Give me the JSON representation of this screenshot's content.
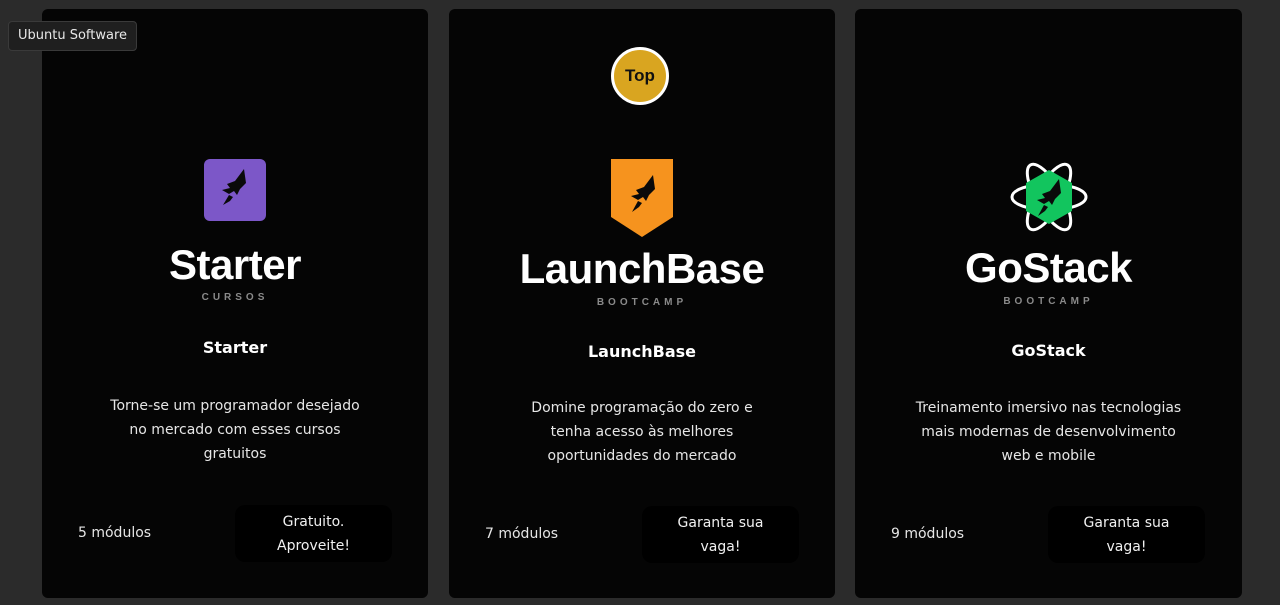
{
  "tooltip": {
    "label": "Ubuntu Software"
  },
  "cards": [
    {
      "brand": "Starter",
      "brand_sub": "CURSOS",
      "title": "Starter",
      "description": "Torne-se um programador desejado no mercado com esses cursos gratuitos",
      "modules": "5 módulos",
      "cta": "Gratuito. Aproveite!",
      "logo_icon": "rocketseat-square-purple-icon",
      "logo_color": "#7c57c8"
    },
    {
      "badge": "Top",
      "brand": "LaunchBase",
      "brand_sub": "BOOTCAMP",
      "title": "LaunchBase",
      "description": "Domine programação do zero e tenha acesso às melhores oportunidades do mercado",
      "modules": "7 módulos",
      "cta": "Garanta sua vaga!",
      "logo_icon": "rocketseat-shield-orange-icon",
      "logo_color": "#f6931e"
    },
    {
      "brand": "GoStack",
      "brand_sub": "BOOTCAMP",
      "title": "GoStack",
      "description": "Treinamento imersivo nas tecnologias mais modernas de desenvolvimento web e mobile",
      "modules": "9 módulos",
      "cta": "Garanta sua vaga!",
      "logo_icon": "rocketseat-atom-green-icon",
      "logo_color": "#12c55e"
    }
  ],
  "colors": {
    "background": "#2b2b2b",
    "card": "#050505",
    "badge": "#d9a520"
  }
}
